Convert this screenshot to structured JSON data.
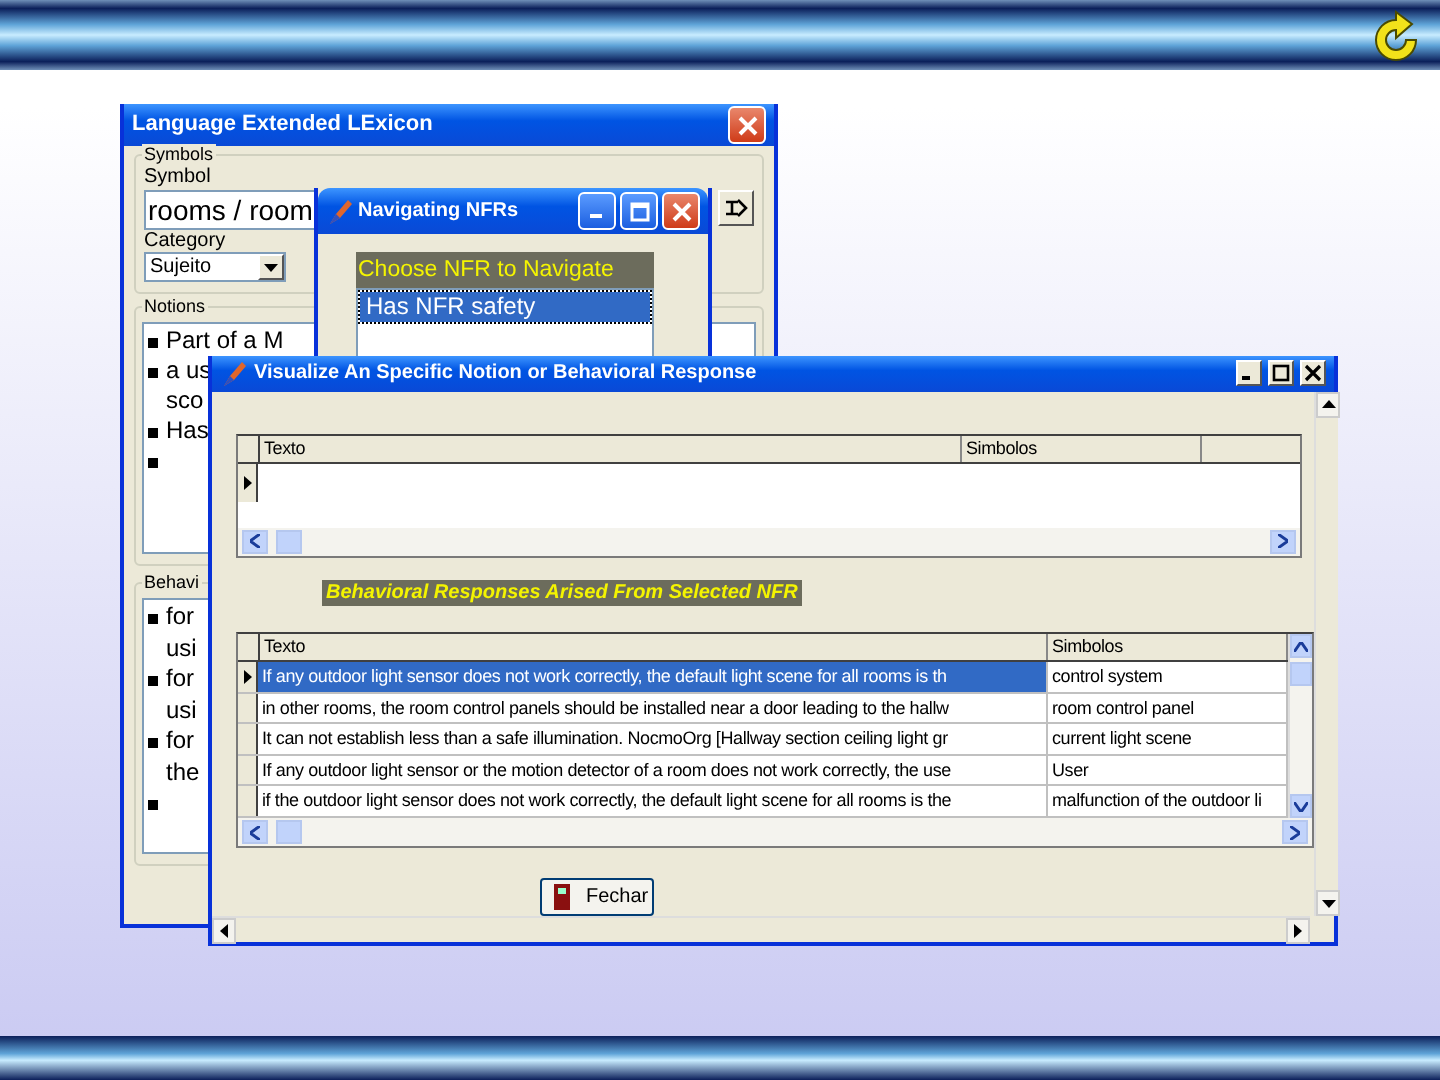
{
  "lexicon_window": {
    "title": "Language Extended LExicon",
    "symbols_group": {
      "legend": "Symbols",
      "symbol_label": "Symbol",
      "symbol_value": "rooms / room",
      "category_label": "Category",
      "category_value": "Sujeito"
    },
    "notions_group": {
      "legend": "Notions",
      "items": [
        {
          "kind": "text",
          "lines": [
            "Part of a M"
          ]
        },
        {
          "kind": "text",
          "lines": [
            "a us",
            "sco"
          ]
        },
        {
          "kind": "text",
          "lines": [
            "Has"
          ]
        },
        {
          "kind": "blank"
        }
      ]
    },
    "behavioral_group": {
      "legend": "Behavi",
      "items": [
        {
          "kind": "text",
          "lines": [
            "for",
            "usi"
          ]
        },
        {
          "kind": "text",
          "lines": [
            "for",
            "usi"
          ]
        },
        {
          "kind": "text",
          "lines": [
            "for",
            "the"
          ]
        },
        {
          "kind": "blank"
        }
      ]
    }
  },
  "nfr_window": {
    "title": "Navigating NFRs",
    "heading": "Choose NFR to Navigate",
    "items": [
      {
        "text": "Has NFR safety",
        "selected": true
      }
    ]
  },
  "visualize_window": {
    "title": "Visualize An Specific Notion or Behavioral Response",
    "notion_table": {
      "columns": [
        "Texto",
        "Simbolos"
      ]
    },
    "responses_heading": "Behavioral Responses Arised From Selected NFR",
    "responses_table": {
      "columns": [
        "Texto",
        "Simbolos"
      ],
      "rows": [
        {
          "cells": [
            "If any outdoor light sensor does not work correctly, the default light scene for all rooms is th",
            "control system"
          ],
          "selected": true
        },
        {
          "cells": [
            "in other rooms, the room control panels should be installed near a door leading to the hallw",
            "room control panel"
          ],
          "selected": false
        },
        {
          "cells": [
            "It can not establish less than a safe illumination. NocmoOrg [Hallway section ceiling light gr",
            "current light scene"
          ],
          "selected": false
        },
        {
          "cells": [
            "If any outdoor light sensor or the motion detector of a room does not work correctly, the use",
            "User"
          ],
          "selected": false
        },
        {
          "cells": [
            "if the outdoor light sensor does not work correctly, the default light scene for all rooms is the",
            "malfunction of the outdoor li"
          ],
          "selected": false
        }
      ]
    },
    "close_button": "Fechar"
  }
}
